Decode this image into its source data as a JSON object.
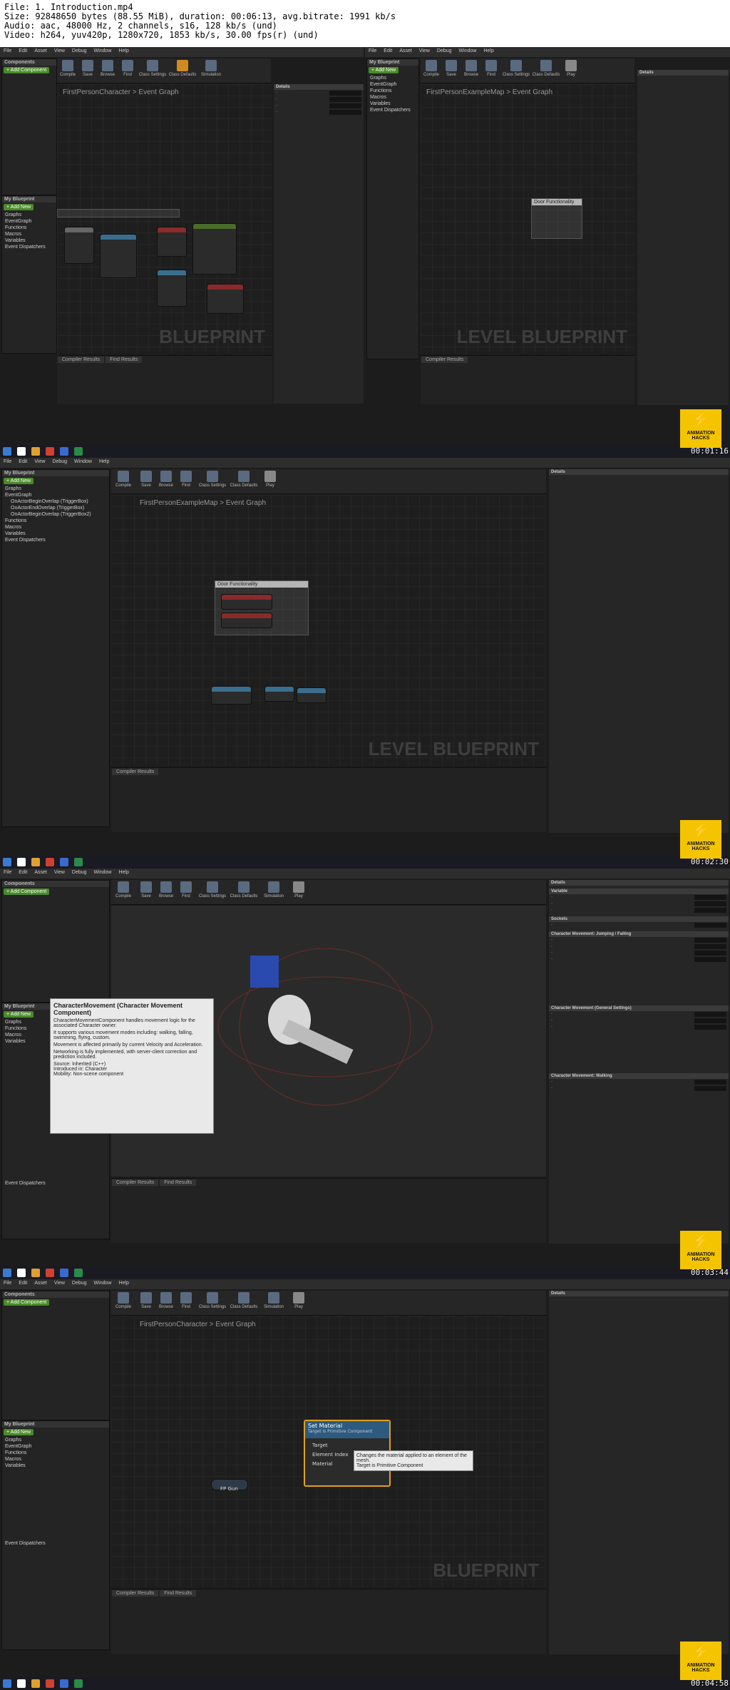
{
  "header": {
    "file": "File: 1. Introduction.mp4",
    "size": "Size: 92848650 bytes (88.55 MiB), duration: 00:06:13, avg.bitrate: 1991 kb/s",
    "audio": "Audio: aac, 48000 Hz, 2 channels, s16, 128 kb/s (und)",
    "video": "Video: h264, yuv420p, 1280x720, 1853 kb/s, 30.00 fps(r) (und)"
  },
  "menu": [
    "File",
    "Edit",
    "Asset",
    "View",
    "Debug",
    "Window",
    "Help"
  ],
  "toolbar": [
    "Compile",
    "Save",
    "Browse",
    "Find",
    "Class Settings",
    "Class Defaults",
    "Simulation",
    "Play"
  ],
  "panels": {
    "components": "Components",
    "add_component": "+ Add Component",
    "my_blueprint": "My Blueprint",
    "add_new": "+ Add New",
    "graphs": "Graphs",
    "event_graph": "EventGraph",
    "functions": "Functions",
    "macros": "Macros",
    "variables": "Variables",
    "event_dispatchers": "Event Dispatchers",
    "compiler_results": "Compiler Results",
    "find_results": "Find Results",
    "details": "Details"
  },
  "frame1": {
    "crumb_left": "FirstPersonCharacter  >  Event Graph",
    "crumb_right": "FirstPersonExampleMap  >  Event Graph",
    "watermark_left": "BLUEPRINT",
    "watermark_right": "LEVEL BLUEPRINT",
    "comment_note": "Door Functionality",
    "timestamp": "00:01:16"
  },
  "frame2": {
    "crumb": "FirstPersonExampleMap  >  Event Graph",
    "watermark": "LEVEL BLUEPRINT",
    "comment": "Door Functionality",
    "graph_items": [
      "OnActorBeginOverlap (TriggerBox)",
      "OnActorEndOverlap (TriggerBox)",
      "OnActorBeginOverlap (TriggerBox2)"
    ],
    "timestamp": "00:02:30"
  },
  "frame3": {
    "tooltip_title": "CharacterMovement (Character Movement Component)",
    "tooltip_lines": [
      "CharacterMovementComponent handles movement logic for the associated Character owner.",
      "It supports various movement modes including: walking, falling, swimming, flying, custom.",
      "Movement is affected primarily by current Velocity and Acceleration.",
      "Networking is fully implemented, with server-client correction and prediction included."
    ],
    "tooltip_source": "Source: Inherited (C++)",
    "tooltip_intro": "Introduced in: Character",
    "tooltip_mobility": "Mobility: Non-scene component",
    "details_sections": [
      "Variable",
      "Sockets",
      "Character Movement: Jumping / Falling",
      "Character Movement (General Settings)",
      "Character Movement: Walking"
    ],
    "timestamp": "00:03:44"
  },
  "frame4": {
    "crumb": "FirstPersonCharacter  >  Event Graph",
    "watermark": "BLUEPRINT",
    "node_title": "Set Material",
    "node_sub": "Target is Primitive Component",
    "pins": [
      "Target",
      "Element Index",
      "Material"
    ],
    "var_node": "FP Gun",
    "tooltip": "Changes the material applied to an element of the mesh.",
    "tooltip2": "Target is Primitive Component",
    "timestamp": "00:04:58"
  },
  "badge": "ANIMATION HACKS",
  "colors": {
    "accent": "#f5c400",
    "add": "#4a8a2a",
    "bg": "#1c1c1c"
  }
}
